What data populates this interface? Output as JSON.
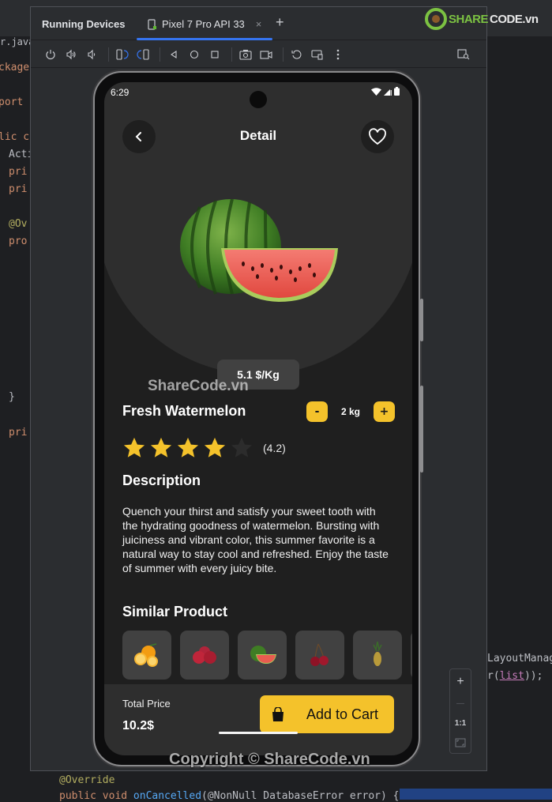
{
  "ide": {
    "file_tab": "r.java",
    "code_left": [
      "ckage",
      "port",
      "lic c",
      "Acti",
      "pri",
      "pri",
      "@Ov",
      "pro",
      "}",
      "pri"
    ],
    "code_right": [
      "LayoutManag",
      "r(",
      "list",
      "));"
    ],
    "code_bottom": [
      "@Override",
      "public void ",
      "onCancelled",
      "(@NonNull DatabaseError error) {"
    ]
  },
  "panel": {
    "title": "Running Devices",
    "device_tab": "Pixel 7 Pro API 33",
    "close_glyph": "×",
    "add_glyph": "+",
    "toolbar_icons": [
      "power-icon",
      "volume-up-icon",
      "volume-down-icon",
      "rotate-left-icon",
      "rotate-right-icon",
      "back-icon",
      "home-icon",
      "overview-icon",
      "screenshot-icon",
      "screen-record-icon",
      "reset-icon",
      "keyboard-icon",
      "more-icon",
      "device-explorer-icon"
    ],
    "zoom_controls": {
      "plus": "+",
      "minus": "—",
      "actual": "1:1"
    }
  },
  "app": {
    "status": {
      "time": "6:29"
    },
    "header": {
      "title": "Detail"
    },
    "product": {
      "price_per_kg": "5.1 $/Kg",
      "name": "Fresh Watermelon",
      "quantity": "2 kg",
      "minus": "-",
      "plus": "+",
      "rating_value": 4.2,
      "rating_label": "(4.2)",
      "stars_filled": 4,
      "stars_total": 5
    },
    "description": {
      "heading": "Description",
      "text": "Quench your thirst and satisfy your sweet tooth with the hydrating goodness of watermelon. Bursting with juiciness and vibrant color, this summer favorite is a natural way to stay cool and refreshed. Enjoy the taste of summer with every juicy bite."
    },
    "similar": {
      "heading": "Similar Product",
      "items": [
        {
          "name": "orange"
        },
        {
          "name": "apple"
        },
        {
          "name": "watermelon"
        },
        {
          "name": "cherry"
        },
        {
          "name": "pineapple"
        }
      ]
    },
    "footer": {
      "total_label": "Total Price",
      "total_value": "10.2$",
      "cart_label": "Add to Cart"
    },
    "colors": {
      "accent": "#f4c22b",
      "background": "#1f1f1f",
      "surface": "#2e2e2e"
    }
  },
  "watermarks": {
    "center": "ShareCode.vn",
    "bottom": "Copyright © ShareCode.vn",
    "logo_a": "SHARE",
    "logo_b": "CODE.vn"
  }
}
